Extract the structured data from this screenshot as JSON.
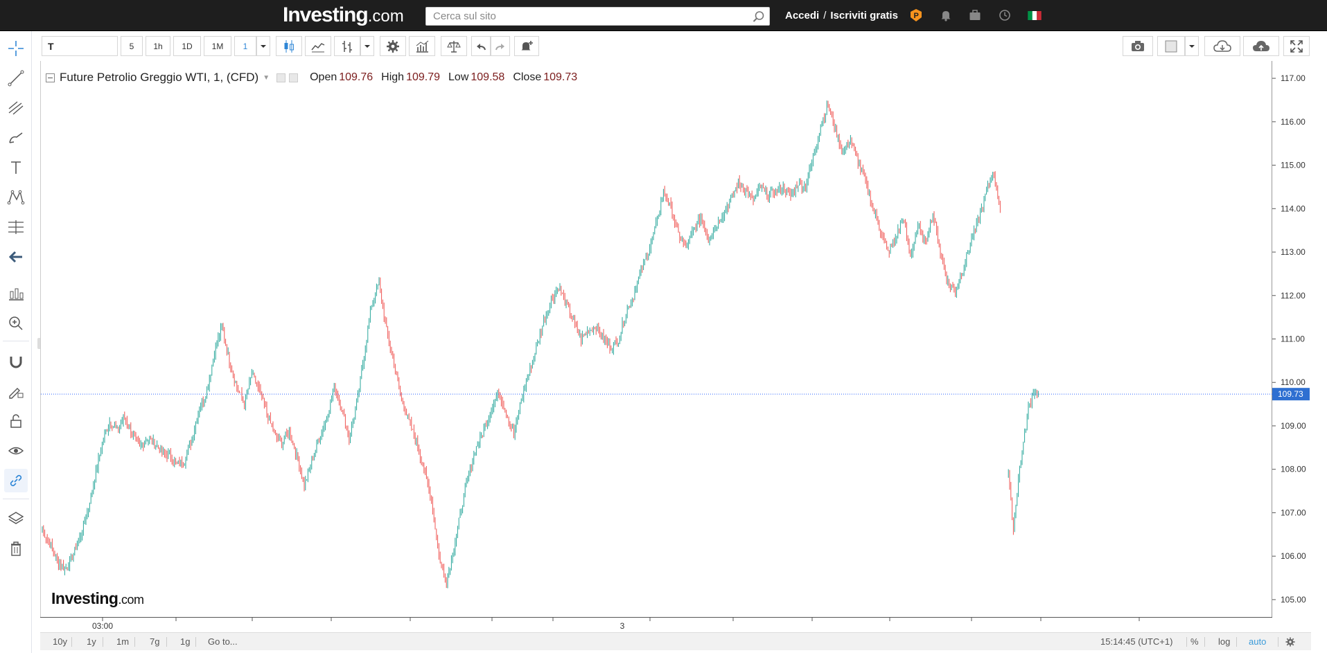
{
  "header": {
    "logo_main": "Investing",
    "logo_domain": ".com",
    "search_placeholder": "Cerca sul sito",
    "login": "Accedi",
    "separator": "/",
    "signup": "Iscriviti gratis"
  },
  "toolbar": {
    "symbol": "T",
    "intervals": [
      "5",
      "1h",
      "1D",
      "1M",
      "1"
    ],
    "selected_interval": "1"
  },
  "legend": {
    "title": "Future Petrolio Greggio WTI, 1, (CFD)",
    "open_label": "Open",
    "open": "109.76",
    "high_label": "High",
    "high": "109.79",
    "low_label": "Low",
    "low": "109.58",
    "close_label": "Close",
    "close": "109.73"
  },
  "watermark": {
    "main": "Investing",
    "domain": ".com"
  },
  "price_axis": {
    "ticks": [
      "117.00",
      "116.00",
      "115.00",
      "114.00",
      "113.00",
      "112.00",
      "111.00",
      "110.00",
      "109.00",
      "108.00",
      "107.00",
      "106.00",
      "105.00"
    ],
    "current_price": "109.73"
  },
  "time_axis": {
    "labels": [
      "03:00",
      "3"
    ]
  },
  "bottom": {
    "ranges": [
      "10y",
      "1y",
      "1m",
      "7g",
      "1g"
    ],
    "goto": "Go to...",
    "clock": "15:14:45 (UTC+1)",
    "percent": "%",
    "log": "log",
    "auto": "auto"
  },
  "colors": {
    "up": "#26a69a",
    "down": "#ef5350",
    "price_line": "#2962ff",
    "price_badge": "#2e6fd1",
    "topbar": "#1e1e1e",
    "accent": "#3a9ad9"
  },
  "chart_data": {
    "type": "line",
    "title": "Future Petrolio Greggio WTI, 1, (CFD)",
    "xlabel": "",
    "ylabel": "",
    "ylim": [
      104.6,
      117.4
    ],
    "x_ticks": [
      "03:00",
      "3"
    ],
    "series": [
      {
        "values": [
          106.6,
          106.3,
          105.9,
          105.7,
          106.0,
          106.4,
          107.0,
          107.8,
          108.6,
          109.1,
          108.9,
          109.2,
          108.8,
          108.5,
          108.7,
          108.6,
          108.4,
          108.3,
          108.1,
          108.2,
          108.7,
          109.4,
          109.8,
          110.7,
          111.3,
          110.5,
          109.9,
          109.5,
          110.2,
          109.8,
          109.3,
          108.8,
          108.6,
          108.9,
          108.3,
          107.6,
          108.2,
          108.7,
          109.2,
          109.9,
          109.4,
          108.7,
          109.5,
          110.6,
          111.8,
          112.3,
          111.2,
          110.4,
          109.6,
          109.1,
          108.6,
          108.0,
          107.3,
          106.0,
          105.4,
          106.2,
          107.1,
          107.9,
          108.5,
          108.9,
          109.4,
          109.8,
          109.3,
          108.8,
          109.6,
          110.2,
          110.8,
          111.4,
          111.9,
          112.2,
          111.8,
          111.4,
          111.0,
          111.2,
          111.3,
          111.0,
          110.8,
          111.0,
          111.6,
          112.0,
          112.6,
          113.0,
          113.6,
          114.4,
          114.0,
          113.4,
          113.1,
          113.5,
          113.8,
          113.3,
          113.6,
          113.9,
          114.2,
          114.6,
          114.4,
          114.2,
          114.5,
          114.3,
          114.4,
          114.5,
          114.3,
          114.6,
          114.5,
          115.2,
          115.9,
          116.4,
          115.8,
          115.3,
          115.6,
          115.1,
          114.6,
          114.0,
          113.5,
          113.0,
          113.3,
          113.8,
          112.9,
          113.6,
          113.2,
          113.9,
          113.0,
          112.3,
          112.1,
          112.6,
          113.2,
          113.7,
          114.3,
          114.9,
          114.0
        ],
        "gap_after_index": 127,
        "after_gap_values": [
          107.9,
          106.6,
          107.8,
          108.6,
          109.4,
          109.8,
          109.73
        ]
      }
    ],
    "grid": false,
    "legend": "top-left"
  }
}
